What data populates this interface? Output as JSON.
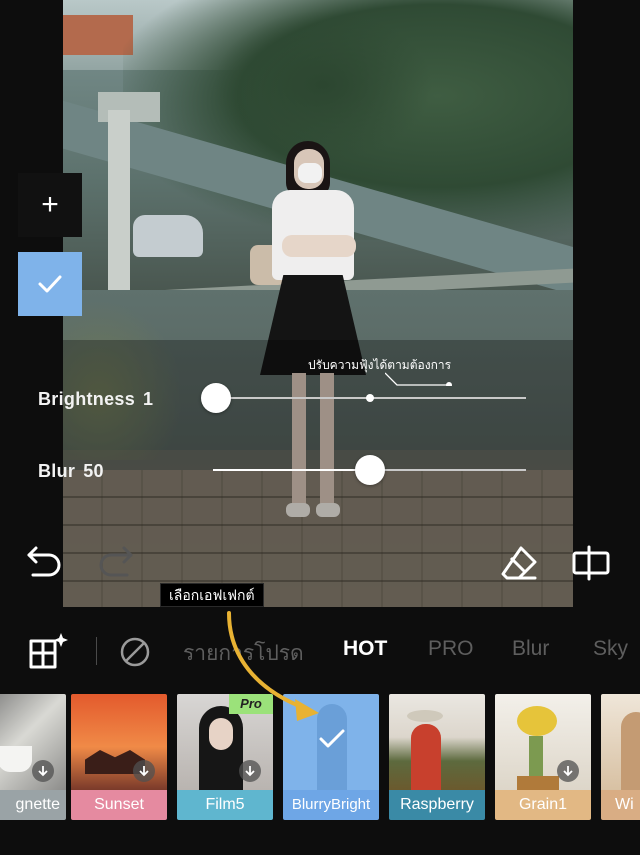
{
  "tools": {
    "add_label": "+"
  },
  "adjustments": {
    "hint": "ปรับความฟุ้งได้ตามต้องการ",
    "brightness": {
      "label": "Brightness",
      "value": "1",
      "level": 0.01
    },
    "blur": {
      "label": "Blur",
      "value": "50",
      "level": 0.5
    }
  },
  "instruction": "เลือกเอฟเฟกต์",
  "tabs": [
    {
      "label": "รายการโปรด",
      "active": false
    },
    {
      "label": "HOT",
      "active": true
    },
    {
      "label": "PRO",
      "active": false
    },
    {
      "label": "Blur",
      "active": false
    },
    {
      "label": "Sky",
      "active": false
    }
  ],
  "effects": [
    {
      "label": "Vignette",
      "display": "gnette",
      "color": "#9aa3a6",
      "download": true
    },
    {
      "label": "Sunset",
      "color": "#e58aa0",
      "download": true
    },
    {
      "label": "Film5",
      "color": "#5fb6cf",
      "download": true,
      "pro": "Pro"
    },
    {
      "label": "BlurryBright",
      "color": "#6ea6e6",
      "selected": true
    },
    {
      "label": "Raspberry",
      "color": "#3a8aa6",
      "download": false
    },
    {
      "label": "Grain1",
      "color": "#e2b884",
      "download": true
    },
    {
      "label": "Wi",
      "color": "#d9ad84",
      "download": false
    }
  ],
  "colors": {
    "accent": "#7fb3ea",
    "arrow": "#e8b233",
    "pro_badge": "#9be27a"
  }
}
